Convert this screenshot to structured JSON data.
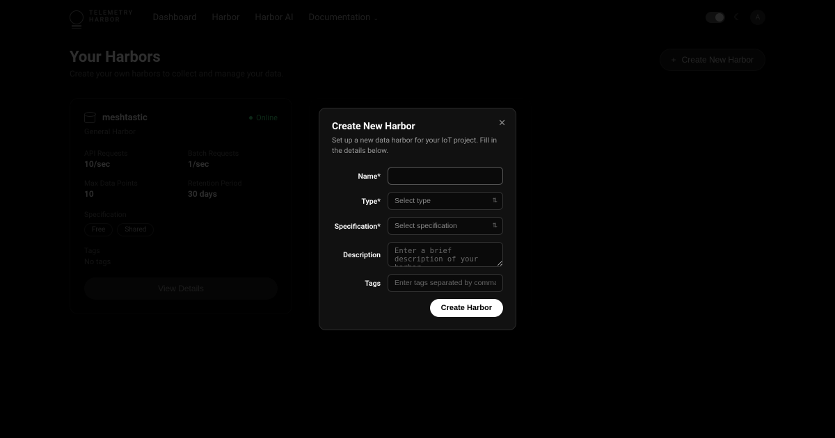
{
  "brand": {
    "line1": "TELEMETRY",
    "line2": "HARBOR"
  },
  "nav": {
    "dashboard": "Dashboard",
    "harbor": "Harbor",
    "harbor_ai": "Harbor AI",
    "docs": "Documentation"
  },
  "avatar_initial": "A",
  "page": {
    "title": "Your Harbors",
    "subtitle": "Create your own harbors to collect and manage your data."
  },
  "create_button": "Create New Harbor",
  "card": {
    "name": "meshtastic",
    "status": "Online",
    "type": "General Harbor",
    "stats": {
      "api_label": "API Requests",
      "api_value": "10/sec",
      "batch_label": "Batch Requests",
      "batch_value": "1/sec",
      "maxdp_label": "Max Data Points",
      "maxdp_value": "10",
      "retention_label": "Retention Period",
      "retention_value": "30 days"
    },
    "spec_label": "Specification",
    "badges": [
      "Free",
      "Shared"
    ],
    "tags_label": "Tags",
    "no_tags": "No tags",
    "details": "View Details"
  },
  "modal": {
    "title": "Create New Harbor",
    "subtitle": "Set up a new data harbor for your IoT project. Fill in the details below.",
    "name_label": "Name*",
    "type_label": "Type*",
    "type_placeholder": "Select type",
    "spec_label": "Specification*",
    "spec_placeholder": "Select specification",
    "desc_label": "Description",
    "desc_placeholder": "Enter a brief description of your harbor",
    "tags_label": "Tags",
    "tags_placeholder": "Enter tags separated by commas",
    "submit": "Create Harbor"
  }
}
